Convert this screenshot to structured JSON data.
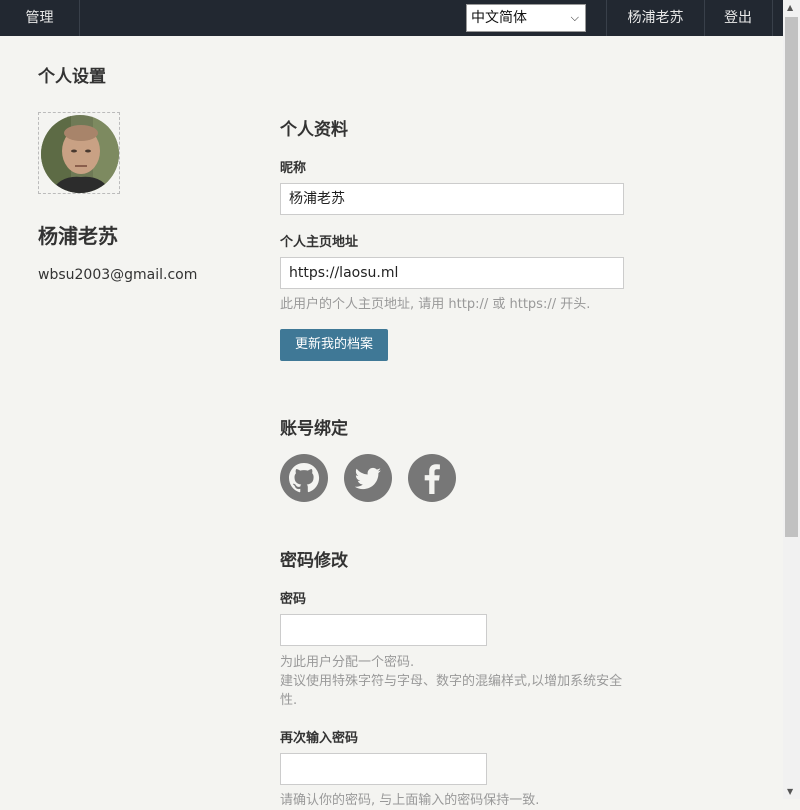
{
  "header": {
    "admin_label": "管理",
    "language_selected": "中文简体",
    "user_label": "杨浦老苏",
    "logout_label": "登出"
  },
  "page": {
    "title": "个人设置"
  },
  "profile": {
    "name": "杨浦老苏",
    "email": "wbsu2003@gmail.com"
  },
  "profile_section": {
    "title": "个人资料",
    "nickname_label": "昵称",
    "nickname_value": "杨浦老苏",
    "homepage_label": "个人主页地址",
    "homepage_value": "https://laosu.ml",
    "homepage_help": "此用户的个人主页地址, 请用 http:// 或 https:// 开头.",
    "update_button": "更新我的档案"
  },
  "binding_section": {
    "title": "账号绑定",
    "icons": [
      "github-icon",
      "twitter-icon",
      "facebook-icon"
    ]
  },
  "password_section": {
    "title": "密码修改",
    "password_label": "密码",
    "password_help_line1": "为此用户分配一个密码.",
    "password_help_line2": "建议使用特殊字符与字母、数字的混编样式,以增加系统安全性.",
    "confirm_label": "再次输入密码",
    "confirm_help": "请确认你的密码, 与上面输入的密码保持一致."
  },
  "colors": {
    "topbar": "#222831",
    "background": "#f4f4f1",
    "button": "#3f7896",
    "social_icon": "#777777"
  }
}
